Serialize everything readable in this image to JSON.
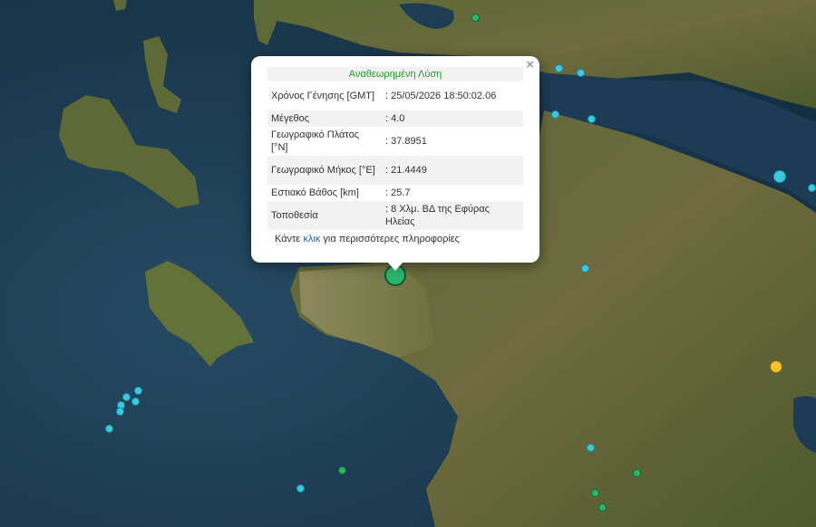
{
  "map": {
    "basemap": "satellite",
    "markers_cyan_small": 22,
    "marker_colors": {
      "cyan": "#3cc8e0",
      "green": "#2bb56a",
      "yellow": "#f2c12e"
    }
  },
  "popup": {
    "title": "Αναθεωρημένη Λύση",
    "close_symbol": "×",
    "rows": [
      {
        "label": "Χρόνος Γένησης [GMT]",
        "value": ": 25/05/2026 18:50:02.06"
      },
      {
        "label": "Μέγεθος",
        "value": ": 4.0"
      },
      {
        "label": "Γεωγραφικό Πλάτος [°N]",
        "value": ": 37.8951"
      },
      {
        "label": "Γεωγραφικό Μήκος [°E]",
        "value": ": 21.4449"
      },
      {
        "label": "Εστιακό Βάθος [km]",
        "value": ": 25.7"
      },
      {
        "label": "Τοποθεσία",
        "value": ": 8 Χλμ. ΒΔ της Εφύρας Ηλείας"
      }
    ],
    "more_before": "Κάντε ",
    "more_link": "κλικ",
    "more_after": " για περισσότερες πληροφορίες"
  }
}
